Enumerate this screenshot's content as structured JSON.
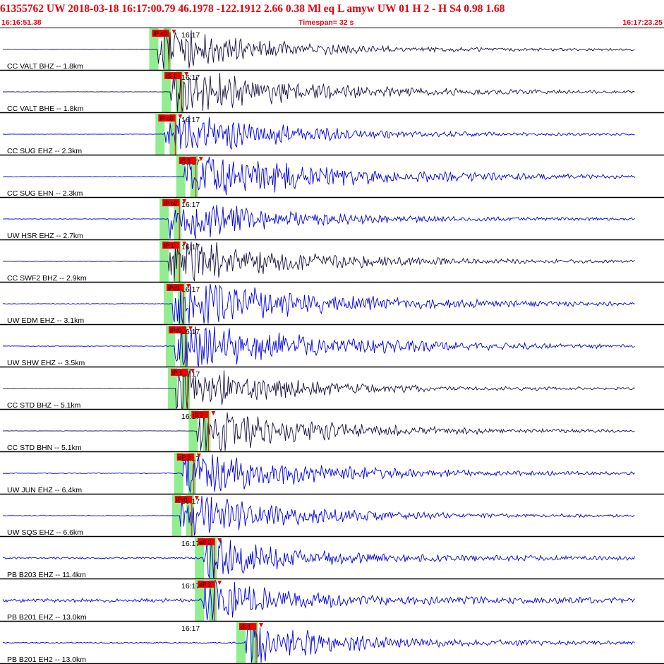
{
  "header": {
    "title": "61355762 UW 2018-03-18 16:17:00.79   46.1978 -122.1912   2.66  0.38 Ml  eq  L amyw    UW 01  H   2  -  H S4    0.98  1.68",
    "start_time": "16:16:51.38",
    "timespan": "Timespan=  32 s",
    "end_time": "16:17:23.25"
  },
  "colors": {
    "header_text": "#e8000f",
    "pick_flag": "#ee0000",
    "trace_blue": "#0000e0",
    "trace_dark": "#1a1040",
    "pick_window": "#90ee90"
  },
  "chart_data": {
    "type": "line",
    "title": "61355762 UW 2018-03-18 16:17:00.79",
    "x_unit": "time",
    "x_start": "16:16:51.38",
    "x_end": "16:17:23.25",
    "timespan_s": 32,
    "panel_time_label": "16:17",
    "traces": [
      {
        "label": "CC VALT BHZ -- 1.8km",
        "pick": "iP c0",
        "color": "dark",
        "p_s": 7.6,
        "s_s": null,
        "amp": 1.0,
        "noise": 0.08,
        "env": 1.2
      },
      {
        "label": "CC VALT BHE -- 1.8km",
        "pick": "iS 1",
        "color": "dark",
        "p_s": null,
        "s_s": 8.2,
        "amp": 1.0,
        "noise": 0.08,
        "env": 1.6
      },
      {
        "label": "CC SUG EHZ -- 2.3km",
        "pick": "iP c0",
        "color": "blue",
        "p_s": 7.9,
        "s_s": null,
        "amp": 1.0,
        "noise": 0.08,
        "env": 1.4
      },
      {
        "label": "CC SUG EHN -- 2.3km",
        "pick": "iS 1",
        "color": "blue",
        "p_s": null,
        "s_s": 8.9,
        "amp": 1.0,
        "noise": 0.1,
        "env": 2.0
      },
      {
        "label": "UW HSR EHZ -- 2.7km",
        "pick": "iP c0",
        "color": "blue",
        "p_s": 8.1,
        "s_s": null,
        "amp": 1.0,
        "noise": 0.12,
        "env": 1.2
      },
      {
        "label": "CC SWF2 BHZ -- 2.9km",
        "pick": "iP 1",
        "color": "dark",
        "p_s": 8.1,
        "s_s": null,
        "amp": 1.0,
        "noise": 0.1,
        "env": 1.6
      },
      {
        "label": "UW EDM EHZ -- 3.1km",
        "pick": "iPd1",
        "color": "blue",
        "p_s": 8.3,
        "s_s": null,
        "amp": 1.0,
        "noise": 0.12,
        "env": 2.0
      },
      {
        "label": "UW SHW EHZ -- 3.5km",
        "pick": "iPc0",
        "color": "blue",
        "p_s": 8.4,
        "s_s": null,
        "amp": 1.0,
        "noise": 0.12,
        "env": 2.0
      },
      {
        "label": "CC STD BHZ -- 5.1km",
        "pick": "iP 1",
        "color": "dark",
        "p_s": 8.5,
        "s_s": null,
        "amp": 1.0,
        "noise": 0.1,
        "env": 1.3
      },
      {
        "label": "CC STD BHN -- 5.1km",
        "pick": "iS 2",
        "color": "dark",
        "p_s": null,
        "s_s": 9.5,
        "amp": 1.0,
        "noise": 0.08,
        "env": 1.5
      },
      {
        "label": "UW JUN EHZ -- 6.4km",
        "pick": "eP 2",
        "color": "blue",
        "p_s": 8.8,
        "s_s": null,
        "amp": 1.0,
        "noise": 0.15,
        "env": 1.5
      },
      {
        "label": "UW SQS EHZ -- 6.6km",
        "pick": "iPd1",
        "color": "blue",
        "p_s": 8.7,
        "s_s": null,
        "amp": 1.0,
        "noise": 0.12,
        "env": 1.3
      },
      {
        "label": "PB B203 EHZ -- 11.4km",
        "pick": "eP 2",
        "color": "blue",
        "p_s": 9.8,
        "s_s": null,
        "amp": 1.0,
        "noise": 0.35,
        "env": 1.0
      },
      {
        "label": "PB B201 EHZ -- 13.0km",
        "pick": "eP 2",
        "color": "blue",
        "p_s": 9.8,
        "s_s": null,
        "amp": 1.0,
        "noise": 0.7,
        "env": 0.8
      },
      {
        "label": "PB B201 EH2 -- 13.0km",
        "pick": "iS 1",
        "color": "blue",
        "p_s": null,
        "s_s": 11.8,
        "amp": 1.0,
        "noise": 0.25,
        "env": 1.0
      }
    ]
  }
}
